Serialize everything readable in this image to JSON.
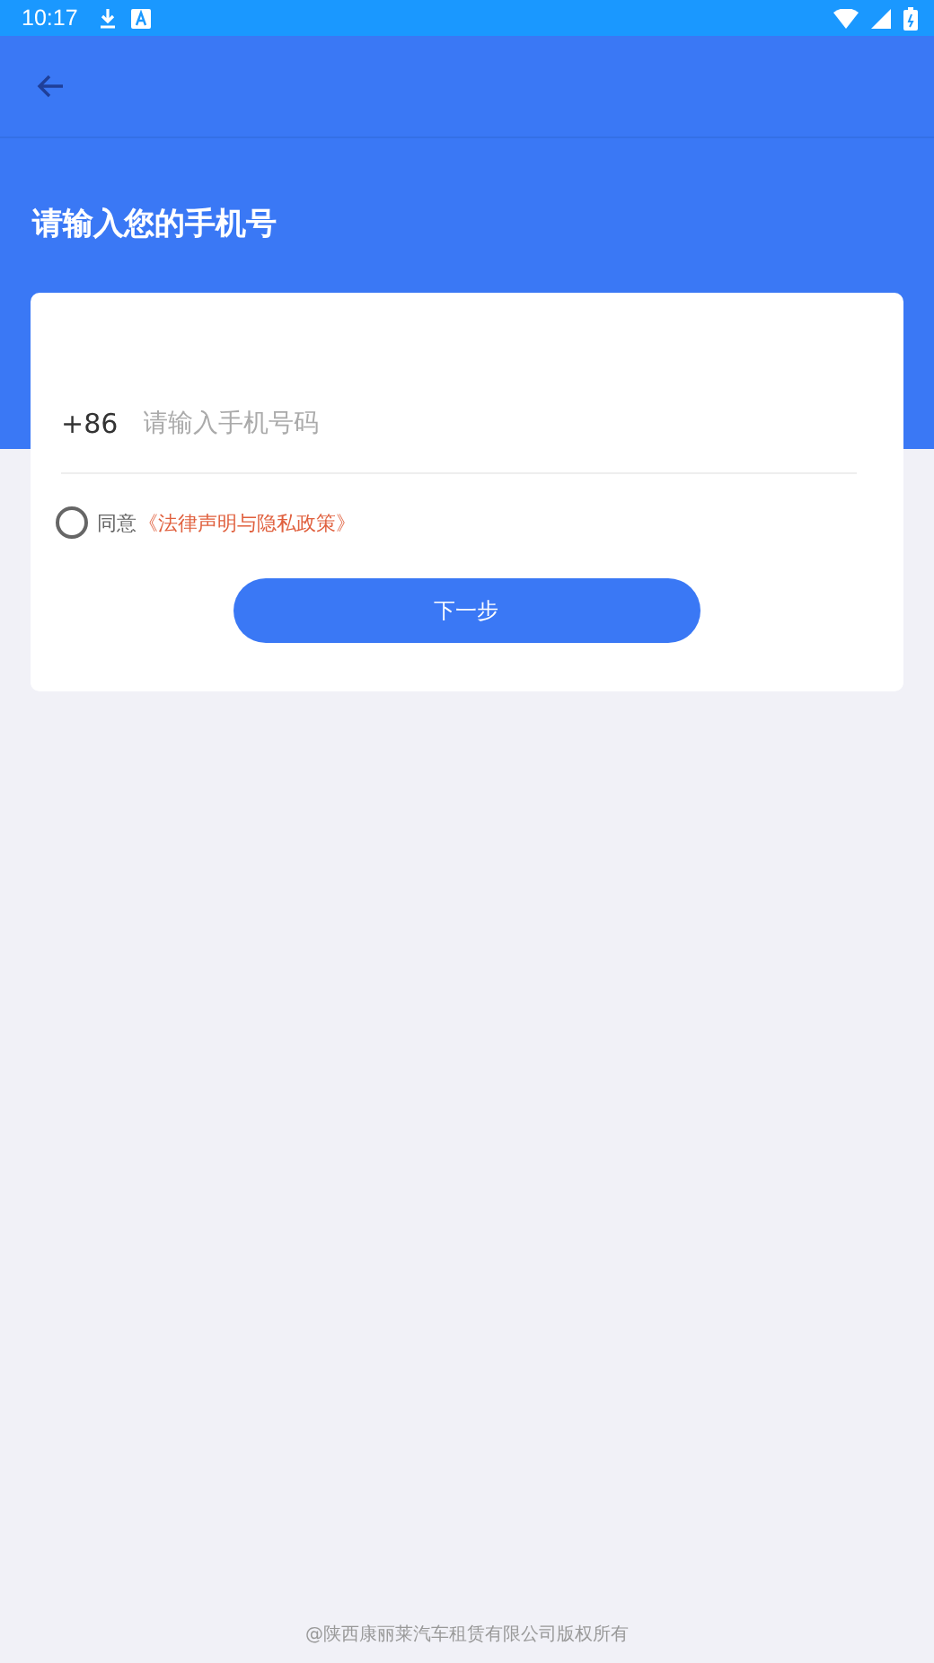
{
  "status_bar": {
    "time": "10:17"
  },
  "header": {
    "title": "请输入您的手机号"
  },
  "form": {
    "country_code": "+86",
    "phone": {
      "placeholder": "请输入手机号码"
    },
    "agreement": {
      "checked": false,
      "prefix": "同意",
      "link": "《法律声明与隐私政策》"
    },
    "next_button": "下一步"
  },
  "footer": "@陕西康丽莱汽车租赁有限公司版权所有"
}
